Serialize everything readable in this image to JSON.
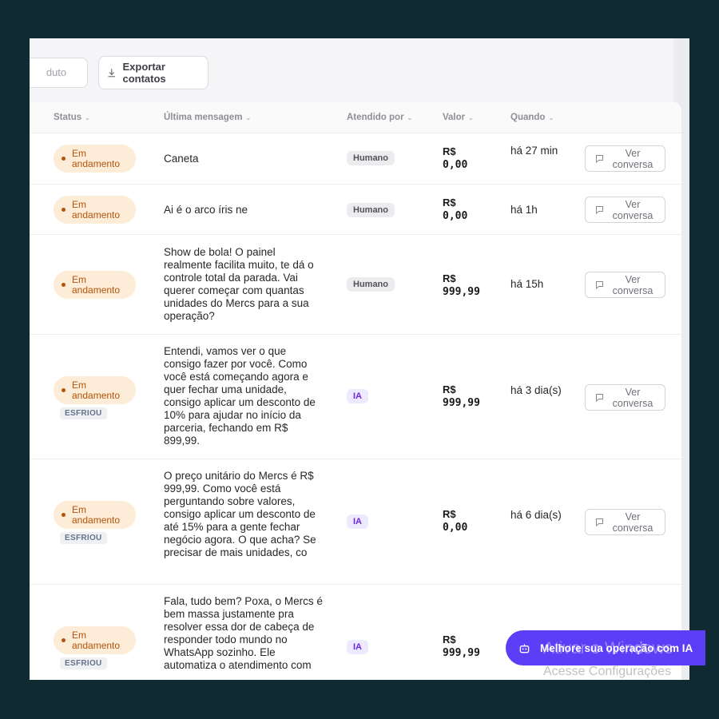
{
  "toolbar": {
    "search_partial": "duto",
    "export_label": "Exportar contatos"
  },
  "columns": {
    "status": "Status",
    "last_message": "Última mensagem",
    "handled_by": "Atendido por",
    "value": "Valor",
    "when": "Quando"
  },
  "rows": [
    {
      "status": "Em\nandamento",
      "tag": "",
      "message": "Caneta",
      "handled_by": "Humano",
      "handler_type": "human",
      "currency": "R$",
      "amount": "0,00",
      "when": "há 27 min",
      "action": "Ver conversa"
    },
    {
      "status": "Em\nandamento",
      "tag": "",
      "message": "Ai é o arco íris ne",
      "handled_by": "Humano",
      "handler_type": "human",
      "currency": "R$",
      "amount": "0,00",
      "when": "há 1h",
      "action": "Ver conversa"
    },
    {
      "status": "Em\nandamento",
      "tag": "",
      "message": "Show de bola! O painel realmente facilita muito, te dá o controle total da parada. Vai querer começar com quantas unidades do Mercs para a sua operação?",
      "handled_by": "Humano",
      "handler_type": "human",
      "currency": "R$",
      "amount": "999,99",
      "when": "há 15h",
      "action": "Ver conversa"
    },
    {
      "status": "Em\nandamento",
      "tag": "ESFRIOU",
      "message": "Entendi, vamos ver o que consigo fazer por você. Como você está começando agora e quer fechar uma unidade, consigo aplicar um desconto de 10% para ajudar no início da parceria, fechando em R$ 899,99.",
      "handled_by": "IA",
      "handler_type": "ia",
      "currency": "R$",
      "amount": "999,99",
      "when": "há 3 dia(s)",
      "action": "Ver conversa"
    },
    {
      "status": "Em\nandamento",
      "tag": "ESFRIOU",
      "message": "O preço unitário do Mercs é R$ 999,99. Como você está perguntando sobre valores, consigo aplicar um desconto de até 15% para a gente fechar negócio agora. O que acha? Se precisar de mais unidades, co",
      "handled_by": "IA",
      "handler_type": "ia",
      "currency": "R$",
      "amount": "0,00",
      "when": "há 6 dia(s)",
      "action": "Ver conversa"
    },
    {
      "status": "Em\nandamento",
      "tag": "ESFRIOU",
      "message": "Fala, tudo bem? Poxa, o Mercs é bem massa justamente pra resolver essa dor de cabeça de responder todo mundo no WhatsApp sozinho. Ele automatiza o atendimento com",
      "handled_by": "IA",
      "handler_type": "ia",
      "currency": "R$",
      "amount": "999,99",
      "when": "",
      "action": ""
    }
  ],
  "cta": {
    "label": "Melhore sua operação com IA"
  },
  "watermark": {
    "line1": "Ativar o Windows",
    "line2": "Acesse Configurações"
  },
  "colors": {
    "accent": "#5b3ef5",
    "status_bg": "#fdecd8",
    "status_text": "#b45309",
    "ia_badge": "#6d28d9"
  }
}
